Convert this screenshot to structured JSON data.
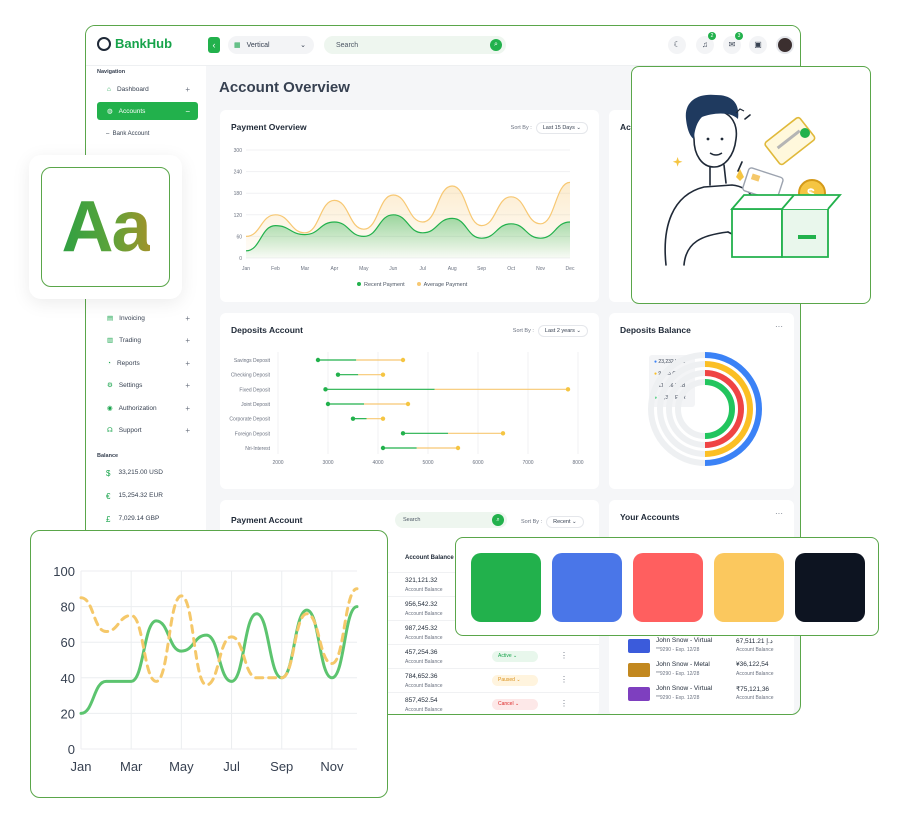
{
  "app": {
    "name": "BankHub"
  },
  "topbar": {
    "layout_select": "Vertical",
    "search_placeholder": "Search",
    "notifications_count": "2",
    "messages_count": "3"
  },
  "sidebar": {
    "nav_title": "Navigation",
    "items": [
      {
        "label": "Dashboard",
        "icon": "home-icon"
      },
      {
        "label": "Accounts",
        "icon": "wallet-icon"
      },
      {
        "label": "Invoicing",
        "icon": "invoice-icon"
      },
      {
        "label": "Trading",
        "icon": "chart-icon"
      },
      {
        "label": "Reports",
        "icon": "report-icon"
      },
      {
        "label": "Settings",
        "icon": "gear-icon"
      },
      {
        "label": "Authorization",
        "icon": "user-icon"
      },
      {
        "label": "Support",
        "icon": "support-icon"
      }
    ],
    "sub_item": "Bank Account",
    "balance_title": "Balance",
    "balances": [
      {
        "symbol": "$",
        "value": "33,215.00 USD"
      },
      {
        "symbol": "€",
        "value": "15,254.32 EUR"
      },
      {
        "symbol": "£",
        "value": "7,029.14 GBP"
      }
    ]
  },
  "main": {
    "page_title": "Account Overview",
    "payment_overview": {
      "title": "Payment Overview",
      "sort_label": "Sort By :",
      "sort_value": "Last 15 Days",
      "legend": [
        "Recent Payment",
        "Average Payment"
      ]
    },
    "ac_partial": "Ac",
    "deposits_account": {
      "title": "Deposits Account",
      "sort_label": "Sort By :",
      "sort_value": "Last 2 years"
    },
    "deposits_balance": {
      "title": "Deposits Balance",
      "legend": [
        {
          "label": "23,232 USD",
          "color": "#3b82f6"
        },
        {
          "label": "9,235 GBP",
          "color": "#fbbf24"
        },
        {
          "label": "11,456 RUB",
          "color": "#ef4444"
        },
        {
          "label": "12,326 EUR",
          "color": "#22c55e"
        }
      ]
    },
    "payment_account": {
      "title": "Payment Account",
      "search_placeholder": "Search",
      "sort_label": "Sort By :",
      "sort_value": "Recent",
      "column": "Account Balance",
      "rows": [
        {
          "value": "321,121.32",
          "sub": "Account Balance",
          "status": ""
        },
        {
          "value": "956,542.32",
          "sub": "Account Balance",
          "status": ""
        },
        {
          "value": "987,245.32",
          "sub": "Account Balance",
          "status": ""
        },
        {
          "value": "457,254.36",
          "sub": "Account Balance",
          "status": "Active"
        },
        {
          "value": "784,652.36",
          "sub": "Account Balance",
          "status": "Paused"
        },
        {
          "value": "857,452.54",
          "sub": "Account Balance",
          "status": "Cancel"
        }
      ]
    },
    "your_accounts": {
      "title": "Your Accounts",
      "rows": [
        {
          "name": "John Snow - Virtual",
          "card": "**9290 - Exp. 12/28",
          "amount": "67,511.21 د.إ",
          "sub": "Account Balance",
          "color": "#3b5bdb"
        },
        {
          "name": "John Snow - Metal",
          "card": "**9290 - Exp. 12/28",
          "amount": "¥36,122,54",
          "sub": "Account Balance",
          "color": "#c2881f"
        },
        {
          "name": "John Snow - Virtual",
          "card": "**9290 - Exp. 12/28",
          "amount": "₹75,121,36",
          "sub": "Account Balance",
          "color": "#7e3fbf"
        }
      ]
    }
  },
  "typography": {
    "sample": "Aa"
  },
  "palette": [
    "#22b14c",
    "#4a76e8",
    "#ff5f5f",
    "#fbc85e",
    "#0d1421"
  ],
  "chart_data": [
    {
      "type": "area",
      "title": "Payment Overview",
      "categories": [
        "Jan",
        "Feb",
        "Mar",
        "Apr",
        "May",
        "Jun",
        "Jul",
        "Aug",
        "Sep",
        "Oct",
        "Nov",
        "Dec"
      ],
      "ylim": [
        0,
        300
      ],
      "yticks": [
        0,
        60,
        120,
        180,
        240,
        300
      ],
      "series": [
        {
          "name": "Recent Payment",
          "color": "#22b14c",
          "values": [
            20,
            90,
            65,
            100,
            60,
            120,
            70,
            110,
            55,
            95,
            55,
            100
          ]
        },
        {
          "name": "Average Payment",
          "color": "#f7c873",
          "values": [
            60,
            120,
            70,
            160,
            80,
            175,
            100,
            200,
            90,
            170,
            95,
            210
          ]
        }
      ]
    },
    {
      "type": "dumbbell",
      "title": "Deposits Account",
      "categories": [
        "Savings Deposit",
        "Checking Deposit",
        "Fixed Deposit",
        "Joint Deposit",
        "Corporate Deposit",
        "Foreign Deposit",
        "Nri-Interest"
      ],
      "xlim": [
        2000,
        8000
      ],
      "xticks": [
        2000,
        3000,
        4000,
        5000,
        6000,
        7000,
        8000
      ],
      "start": [
        2800,
        3200,
        2950,
        3000,
        3500,
        4500,
        4100
      ],
      "end": [
        4500,
        4100,
        7800,
        4600,
        4100,
        6500,
        5600
      ]
    },
    {
      "type": "line",
      "categories": [
        "Jan",
        "Mar",
        "May",
        "Jul",
        "Sep",
        "Nov"
      ],
      "ylim": [
        0,
        100
      ],
      "yticks": [
        0,
        20,
        40,
        60,
        80,
        100
      ],
      "series": [
        {
          "color": "#5cc46f",
          "x": [
            0,
            1,
            2,
            3,
            4,
            5,
            6,
            7,
            8,
            9,
            10,
            11
          ],
          "values": [
            20,
            38,
            38,
            72,
            55,
            64,
            38,
            76,
            40,
            78,
            40,
            80
          ]
        },
        {
          "color": "#f5c86a",
          "x": [
            0,
            1,
            2,
            3,
            4,
            5,
            6,
            7,
            8,
            9,
            10,
            11
          ],
          "values": [
            85,
            66,
            75,
            38,
            86,
            36,
            63,
            40,
            40,
            76,
            48,
            90
          ]
        }
      ]
    }
  ]
}
